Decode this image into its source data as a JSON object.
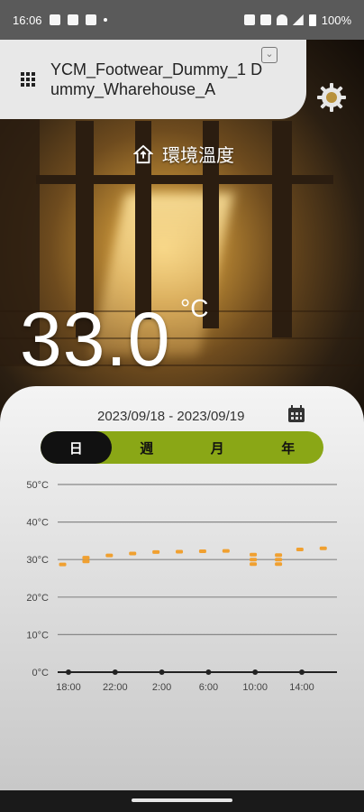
{
  "status_bar": {
    "time": "16:06",
    "battery": "100%"
  },
  "header": {
    "title": "YCM_Footwear_Dummy_1 Dummy_Wharehouse_A"
  },
  "environment": {
    "label": "環境溫度",
    "temperature": "33.0",
    "unit": "°C"
  },
  "panel": {
    "date_range": "2023/09/18 - 2023/09/19",
    "tabs": [
      {
        "label": "日",
        "active": true
      },
      {
        "label": "週",
        "active": false
      },
      {
        "label": "月",
        "active": false
      },
      {
        "label": "年",
        "active": false
      }
    ]
  },
  "colors": {
    "accent": "#8aa716",
    "series": "#f0a030"
  },
  "chart_data": {
    "type": "scatter",
    "title": "",
    "xlabel": "",
    "ylabel": "",
    "y_ticks": [
      "50°C",
      "40°C",
      "30°C",
      "20°C",
      "10°C",
      "0°C"
    ],
    "ylim": [
      0,
      50
    ],
    "x_ticks": [
      "18:00",
      "22:00",
      "2:00",
      "6:00",
      "10:00",
      "14:00"
    ],
    "series": [
      {
        "name": "",
        "points": [
          {
            "x": "17:30",
            "y": 28.7
          },
          {
            "x": "19:30",
            "y": 29.5
          },
          {
            "x": "19:30",
            "y": 30.5
          },
          {
            "x": "21:30",
            "y": 31.1
          },
          {
            "x": "23:30",
            "y": 31.6
          },
          {
            "x": "1:30",
            "y": 32.0
          },
          {
            "x": "3:30",
            "y": 32.1
          },
          {
            "x": "5:30",
            "y": 32.2
          },
          {
            "x": "7:30",
            "y": 32.3
          },
          {
            "x": "9:50",
            "y": 28.8
          },
          {
            "x": "9:50",
            "y": 30.0
          },
          {
            "x": "9:50",
            "y": 31.3
          },
          {
            "x": "12:00",
            "y": 28.8
          },
          {
            "x": "12:00",
            "y": 30.0
          },
          {
            "x": "12:00",
            "y": 31.2
          },
          {
            "x": "13:50",
            "y": 32.7
          },
          {
            "x": "15:50",
            "y": 33.0
          }
        ]
      }
    ]
  }
}
